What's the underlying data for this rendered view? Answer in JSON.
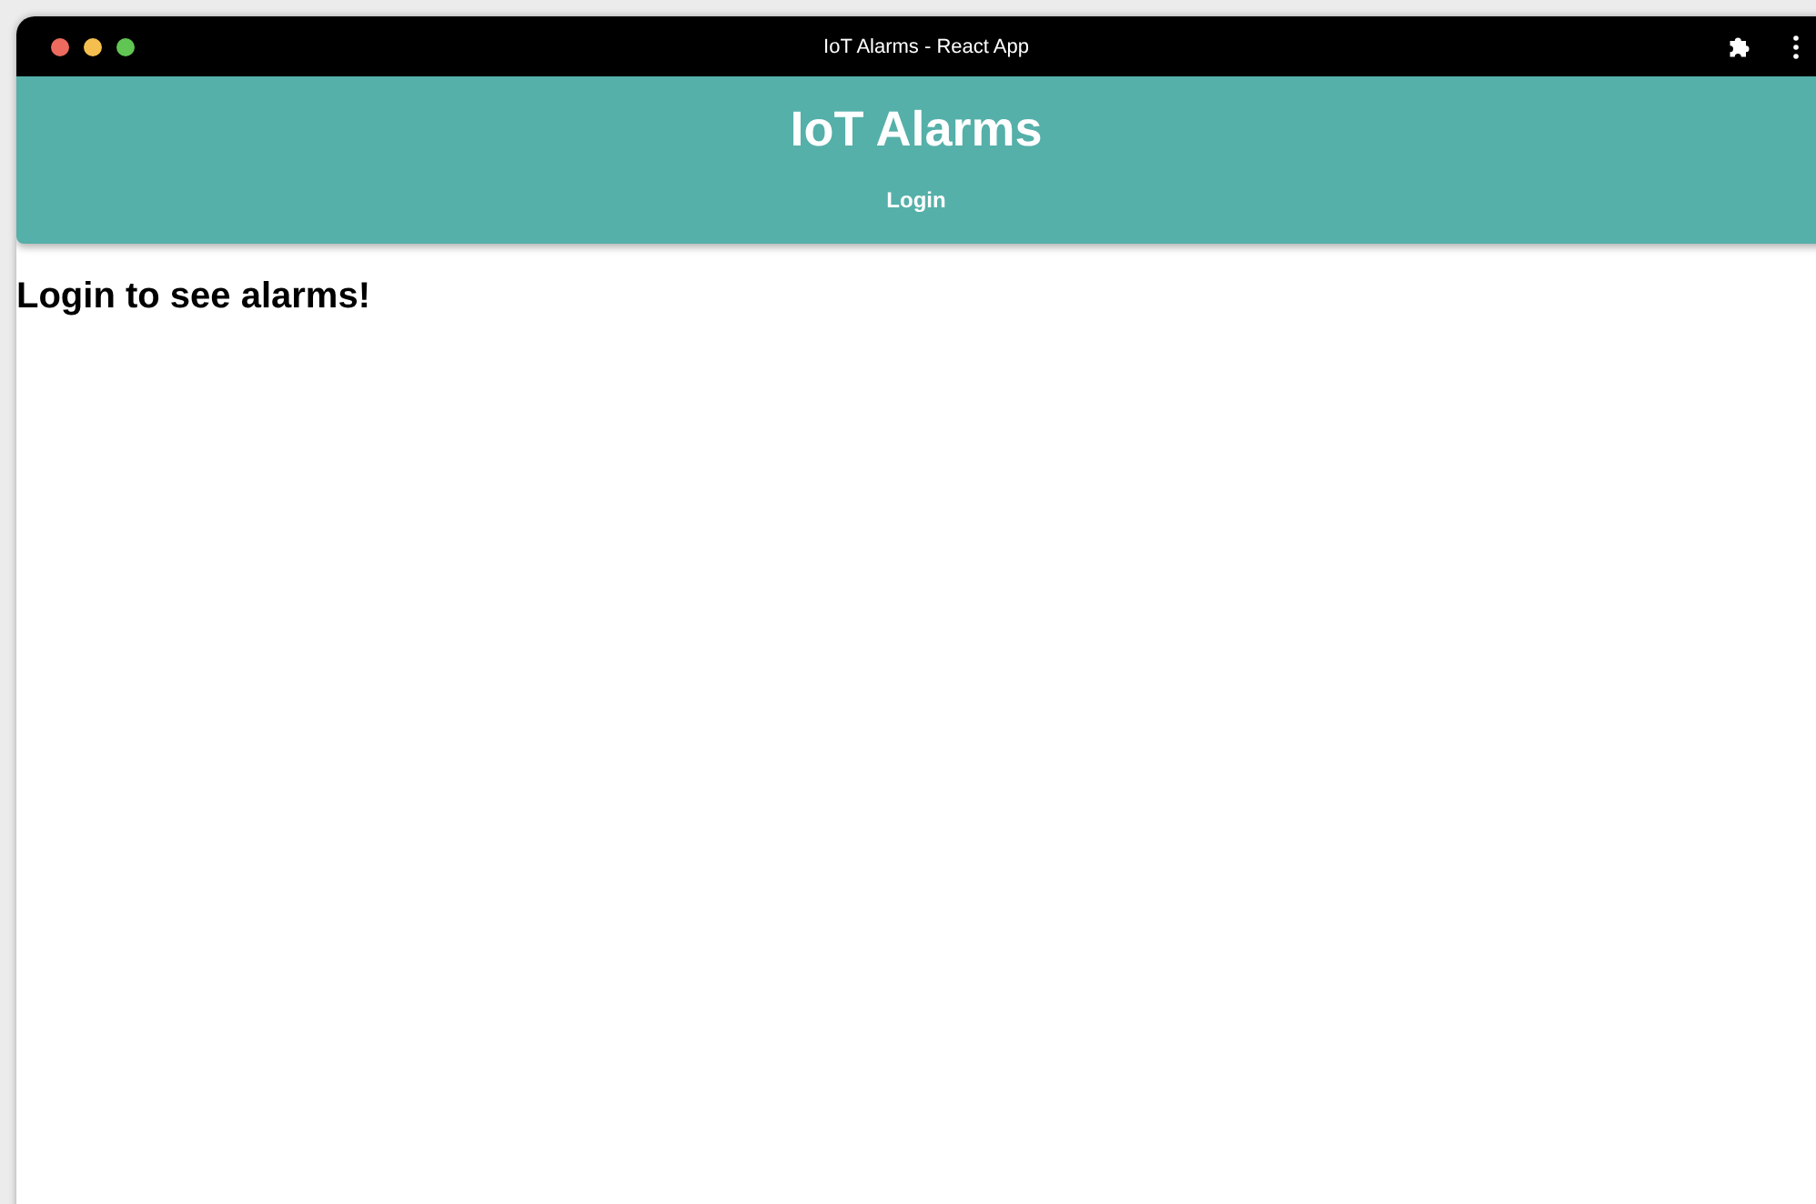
{
  "window": {
    "title": "IoT Alarms - React App"
  },
  "header": {
    "title": "IoT Alarms",
    "nav": [
      {
        "label": "Login"
      }
    ]
  },
  "content": {
    "message": "Login to see alarms!"
  }
}
